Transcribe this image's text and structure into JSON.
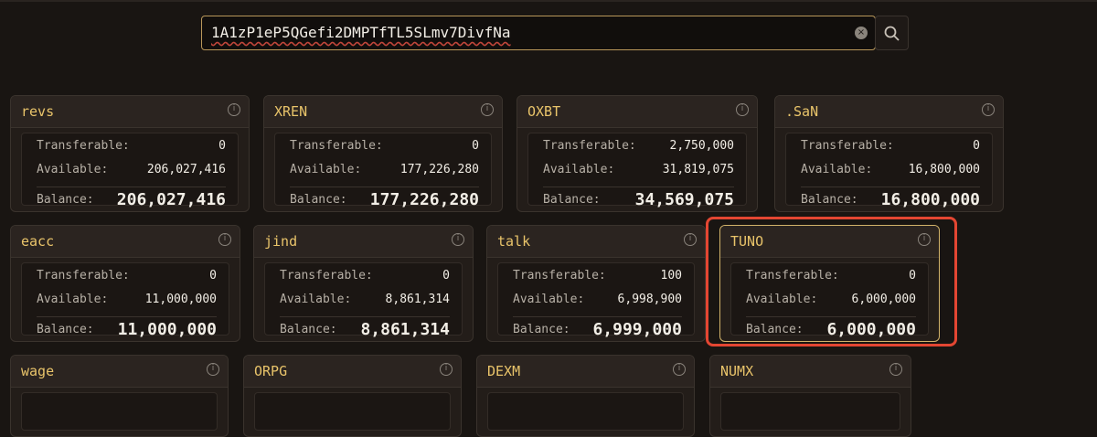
{
  "search": {
    "value": "1A1zP1eP5QGefi2DMPTfTL5SLmv7DivfNa",
    "clear_label": "×"
  },
  "cards": [
    {
      "ticker": "revs",
      "transferable_label": "Transferable:",
      "transferable": "0",
      "available_label": "Available:",
      "available": "206,027,416",
      "balance_label": "Balance:",
      "balance": "206,027,416"
    },
    {
      "ticker": "XREN",
      "transferable_label": "Transferable:",
      "transferable": "0",
      "available_label": "Available:",
      "available": "177,226,280",
      "balance_label": "Balance:",
      "balance": "177,226,280"
    },
    {
      "ticker": "OXBT",
      "transferable_label": "Transferable:",
      "transferable": "2,750,000",
      "available_label": "Available:",
      "available": "31,819,075",
      "balance_label": "Balance:",
      "balance": "34,569,075"
    },
    {
      "ticker": ".SaN",
      "transferable_label": "Transferable:",
      "transferable": "0",
      "available_label": "Available:",
      "available": "16,800,000",
      "balance_label": "Balance:",
      "balance": "16,800,000"
    },
    {
      "ticker": "eacc",
      "transferable_label": "Transferable:",
      "transferable": "0",
      "available_label": "Available:",
      "available": "11,000,000",
      "balance_label": "Balance:",
      "balance": "11,000,000"
    },
    {
      "ticker": "jind",
      "transferable_label": "Transferable:",
      "transferable": "0",
      "available_label": "Available:",
      "available": "8,861,314",
      "balance_label": "Balance:",
      "balance": "8,861,314"
    },
    {
      "ticker": "talk",
      "transferable_label": "Transferable:",
      "transferable": "100",
      "available_label": "Available:",
      "available": "6,998,900",
      "balance_label": "Balance:",
      "balance": "6,999,000"
    },
    {
      "ticker": "TUNO",
      "transferable_label": "Transferable:",
      "transferable": "0",
      "available_label": "Available:",
      "available": "6,000,000",
      "balance_label": "Balance:",
      "balance": "6,000,000"
    },
    {
      "ticker": "wage"
    },
    {
      "ticker": "ORPG"
    },
    {
      "ticker": "DEXM"
    },
    {
      "ticker": "NUMX"
    }
  ],
  "colors": {
    "accent": "#e9c46a",
    "highlight": "#e34632"
  }
}
